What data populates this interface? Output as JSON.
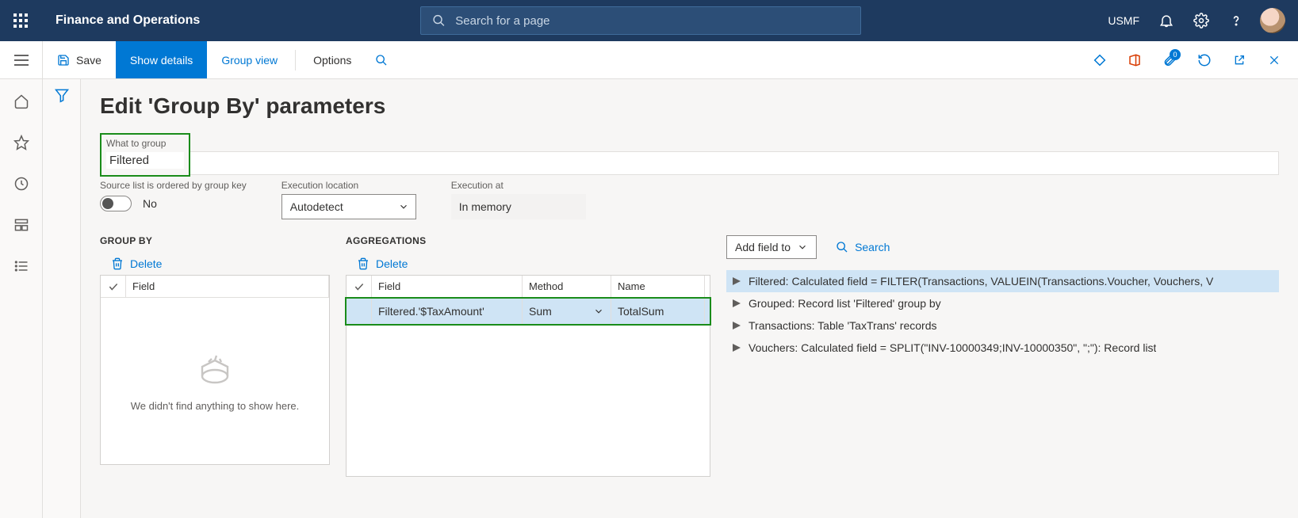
{
  "header": {
    "app_title": "Finance and Operations",
    "search_placeholder": "Search for a page",
    "company": "USMF"
  },
  "cmdbar": {
    "save": "Save",
    "show_details": "Show details",
    "group_view": "Group view",
    "options": "Options",
    "badge": "0"
  },
  "page": {
    "title": "Edit 'Group By' parameters",
    "what_to_group_label": "What to group",
    "what_to_group_value": "Filtered",
    "ordered_label": "Source list is ordered by group key",
    "ordered_value": "No",
    "exec_loc_label": "Execution location",
    "exec_loc_value": "Autodetect",
    "exec_at_label": "Execution at",
    "exec_at_value": "In memory"
  },
  "groupby": {
    "header": "GROUP BY",
    "delete": "Delete",
    "field_col": "Field",
    "empty": "We didn't find anything to show here."
  },
  "agg": {
    "header": "AGGREGATIONS",
    "delete": "Delete",
    "col_field": "Field",
    "col_method": "Method",
    "col_name": "Name",
    "row0": {
      "field": "Filtered.'$TaxAmount'",
      "method": "Sum",
      "name": "TotalSum"
    }
  },
  "tree": {
    "add_field_to": "Add field to",
    "search": "Search",
    "items": [
      "Filtered: Calculated field = FILTER(Transactions, VALUEIN(Transactions.Voucher, Vouchers, V",
      "Grouped: Record list 'Filtered' group by",
      "Transactions: Table 'TaxTrans' records",
      "Vouchers: Calculated field = SPLIT(\"INV-10000349;INV-10000350\", \";\"): Record list"
    ]
  }
}
